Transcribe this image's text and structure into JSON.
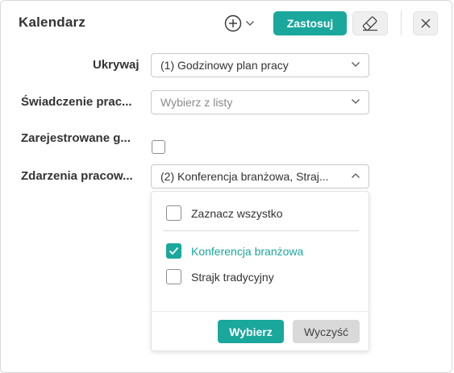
{
  "header": {
    "title": "Kalendarz",
    "add_icon": "plus-circle-icon",
    "apply_label": "Zastosuj",
    "erase_icon": "eraser-icon",
    "close_icon": "close-icon"
  },
  "fields": [
    {
      "label": "Ukrywaj",
      "value": "(1) Godzinowy plan pracy",
      "is_placeholder": false
    },
    {
      "label": "Świadczenie prac...",
      "value": "Wybierz z listy",
      "is_placeholder": true
    },
    {
      "label": "Zarejestrowane g...",
      "checked": false
    },
    {
      "label": "Zdarzenia pracow...",
      "value": "(2) Konferencja branżowa, Straj...",
      "open": true
    }
  ],
  "dropdown": {
    "select_all_label": "Zaznacz wszystko",
    "select_all_checked": false,
    "options": [
      {
        "label": "Konferencja branżowa",
        "checked": true
      },
      {
        "label": "Strajk tradycyjny",
        "checked": false
      }
    ],
    "pick_label": "Wybierz",
    "clear_label": "Wyczyść"
  },
  "colors": {
    "accent": "#1aa79c",
    "secondary_button": "#d9d9d9"
  }
}
